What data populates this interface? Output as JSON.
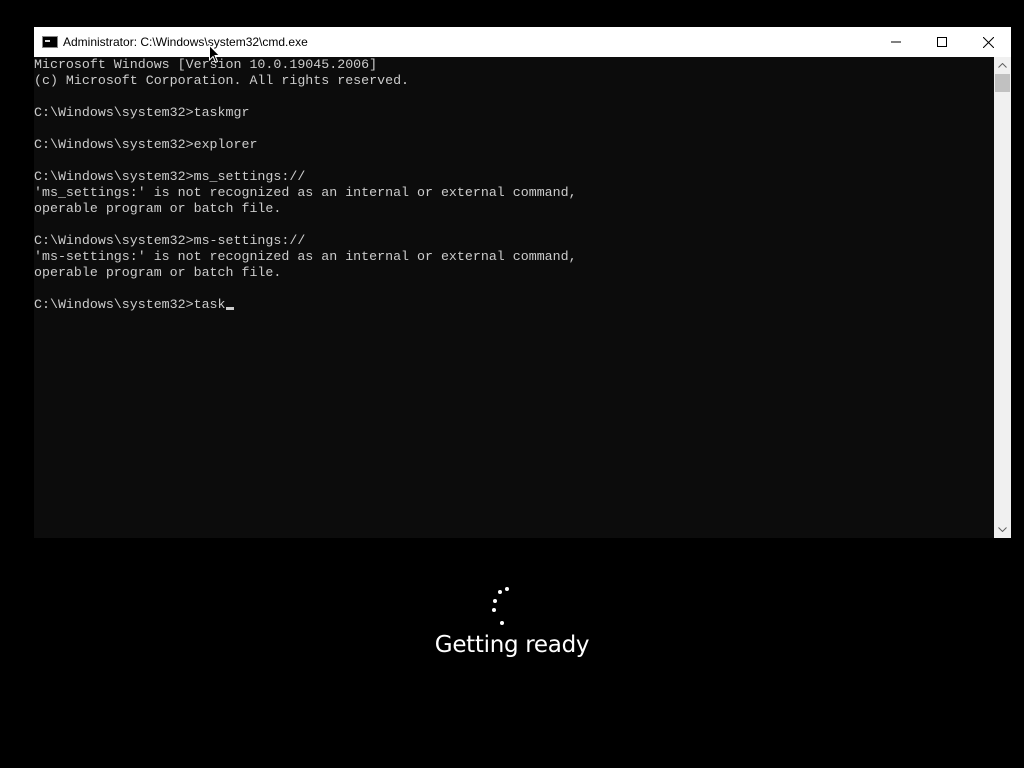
{
  "window": {
    "title": "Administrator: C:\\Windows\\system32\\cmd.exe",
    "app_icon": "cmd-icon",
    "controls": [
      "minimize-icon",
      "maximize-icon",
      "close-icon"
    ]
  },
  "console": {
    "lines": [
      "Microsoft Windows [Version 10.0.19045.2006]",
      "(c) Microsoft Corporation. All rights reserved.",
      "",
      "C:\\Windows\\system32>taskmgr",
      "",
      "C:\\Windows\\system32>explorer",
      "",
      "C:\\Windows\\system32>ms_settings://",
      "'ms_settings:' is not recognized as an internal or external command,",
      "operable program or batch file.",
      "",
      "C:\\Windows\\system32>ms-settings://",
      "'ms-settings:' is not recognized as an internal or external command,",
      "operable program or batch file.",
      ""
    ],
    "current_input": "C:\\Windows\\system32>task"
  },
  "overlay": {
    "status_text": "Getting ready",
    "spinner_icon": "loading-spinner-icon"
  },
  "colors": {
    "console_bg": "#0c0c0c",
    "console_fg": "#cccccc",
    "screen_bg": "#000000",
    "titlebar_bg": "#ffffff"
  }
}
